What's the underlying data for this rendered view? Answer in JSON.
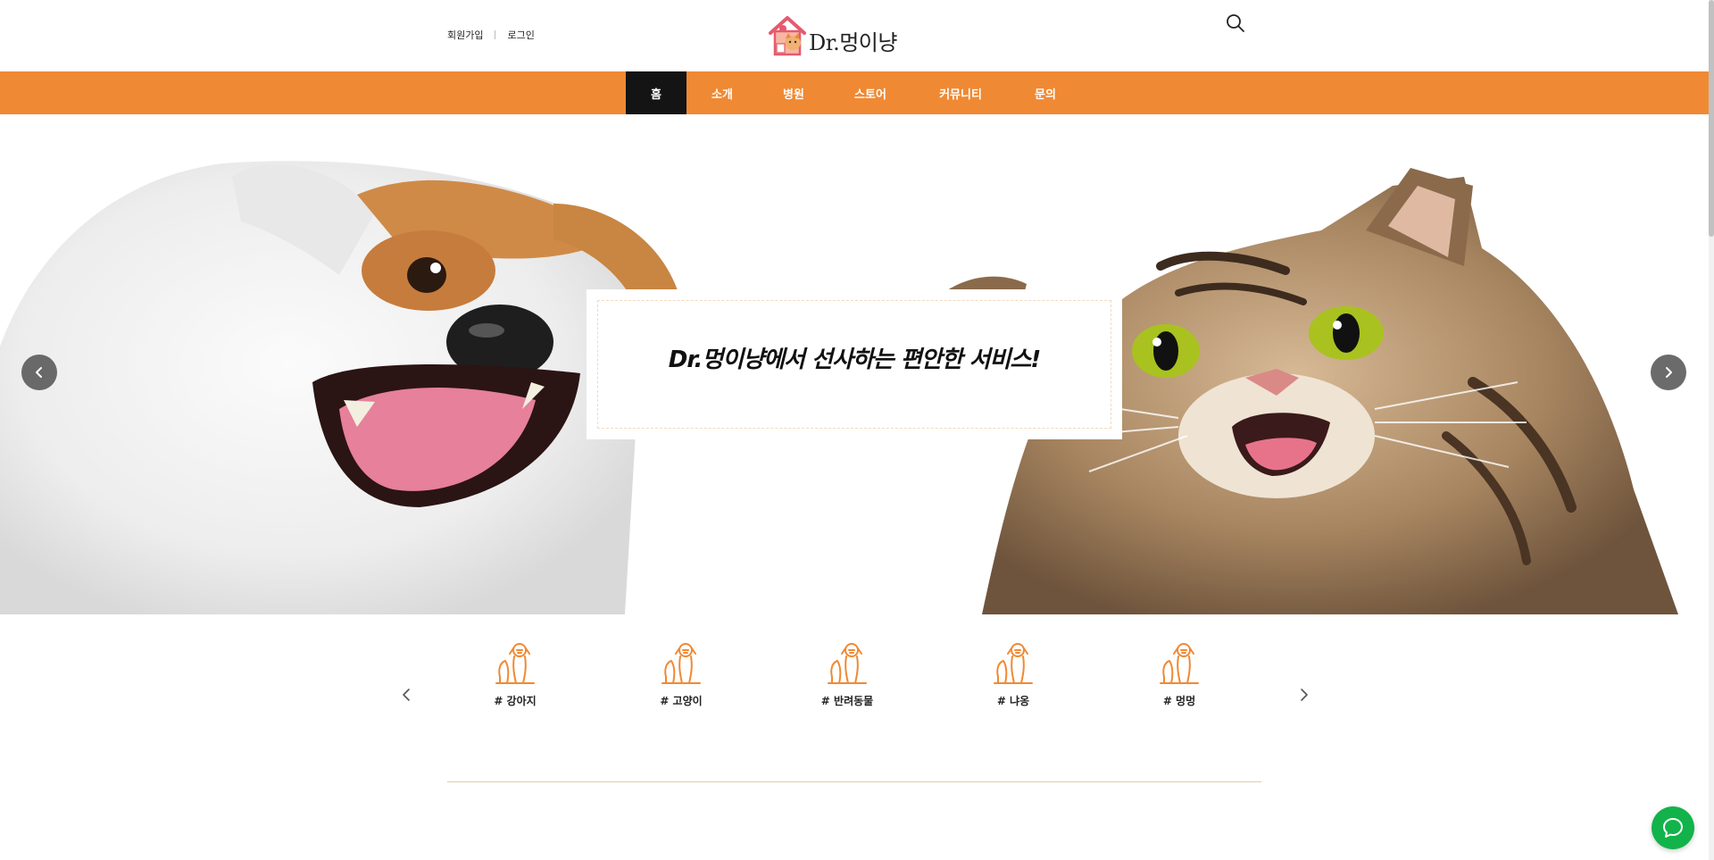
{
  "header": {
    "signup_label": "회원가입",
    "login_label": "로그인",
    "logo_text": "Dr.멍이냥",
    "search_icon": "search-icon"
  },
  "nav": {
    "items": [
      {
        "label": "홈",
        "active": true
      },
      {
        "label": "소개",
        "active": false
      },
      {
        "label": "병원",
        "active": false
      },
      {
        "label": "스토어",
        "active": false
      },
      {
        "label": "커뮤니티",
        "active": false
      },
      {
        "label": "문의",
        "active": false
      }
    ]
  },
  "hero": {
    "caption": "Dr.멍이냥에서 선사하는 편안한 서비스!",
    "prev_icon": "chevron-left-icon",
    "next_icon": "chevron-right-icon"
  },
  "categories": {
    "items": [
      {
        "label": "# 강아지",
        "icon": "pet-icon"
      },
      {
        "label": "# 고양이",
        "icon": "pet-icon"
      },
      {
        "label": "# 반려동물",
        "icon": "pet-icon"
      },
      {
        "label": "# 냐옹",
        "icon": "pet-icon"
      },
      {
        "label": "# 멍멍",
        "icon": "pet-icon"
      }
    ]
  },
  "chat": {
    "icon": "chat-icon"
  },
  "colors": {
    "accent": "#f08933",
    "nav_active": "#141414",
    "chat": "#12b34a"
  }
}
